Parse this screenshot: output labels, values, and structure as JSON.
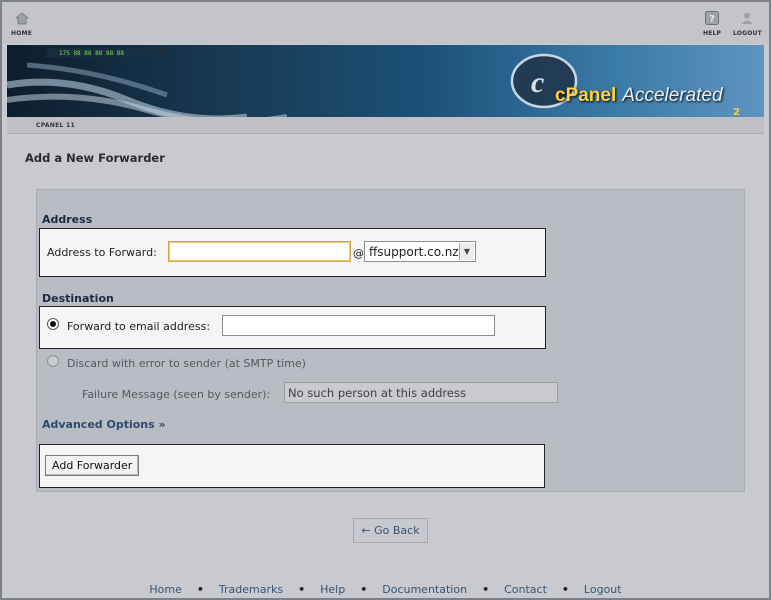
{
  "topnav": {
    "home_label": "HOME",
    "help_label": "HELP",
    "logout_label": "LOGOUT"
  },
  "banner": {
    "brand_c": "cPanel",
    "brand_rest": "Accelerated",
    "brand_num": "2"
  },
  "version": "CPANEL 11",
  "page": {
    "title": "Add a New Forwarder"
  },
  "address": {
    "section_label": "Address",
    "field_label": "Address to Forward:",
    "value": "",
    "at_symbol": "@",
    "domain_selected": "ffsupport.co.nz"
  },
  "destination": {
    "section_label": "Destination",
    "forward_label": "Forward to email address:",
    "forward_value": "",
    "discard_label": "Discard with error to sender (at SMTP time)",
    "failure_label": "Failure Message (seen by sender):",
    "failure_value": "No such person at this address"
  },
  "advanced": {
    "label": "Advanced Options »"
  },
  "actions": {
    "add_label": "Add Forwarder",
    "go_back_label": "← Go Back"
  },
  "footer": {
    "links": [
      "Home",
      "Trademarks",
      "Help",
      "Documentation",
      "Contact",
      "Logout"
    ]
  },
  "colors": {
    "background": "#c4c6cc",
    "link": "#3a5471",
    "section_label": "#1c2a44",
    "focus_border": "#d4a84a"
  }
}
